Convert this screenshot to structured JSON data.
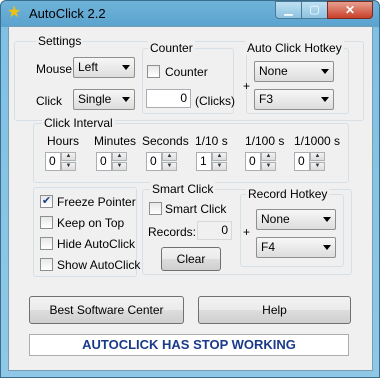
{
  "window": {
    "title": "AutoClick 2.2"
  },
  "settings": {
    "group_label": "Settings",
    "mouse_label": "Mouse",
    "mouse_value": "Left",
    "click_label": "Click",
    "click_value": "Single"
  },
  "counter": {
    "group_label": "Counter",
    "checkbox_label": "Counter",
    "checked": false,
    "value": "0",
    "unit": "(Clicks)"
  },
  "auto_click_hotkey": {
    "group_label": "Auto Click Hotkey",
    "modifier": "None",
    "plus": "+",
    "key": "F3"
  },
  "click_interval": {
    "group_label": "Click Interval",
    "fields": [
      {
        "label": "Hours",
        "value": "0"
      },
      {
        "label": "Minutes",
        "value": "0"
      },
      {
        "label": "Seconds",
        "value": "0"
      },
      {
        "label": "1/10 s",
        "value": "1"
      },
      {
        "label": "1/100 s",
        "value": "0"
      },
      {
        "label": "1/1000 s",
        "value": "0"
      }
    ]
  },
  "options": [
    {
      "label": "Freeze Pointer",
      "checked": true
    },
    {
      "label": "Keep on Top",
      "checked": false
    },
    {
      "label": "Hide AutoClick",
      "checked": false
    },
    {
      "label": "Show AutoClick",
      "checked": false
    }
  ],
  "smart_click": {
    "group_label": "Smart Click",
    "checkbox_label": "Smart Click",
    "checked": false,
    "records_label": "Records:",
    "records_value": "0",
    "clear_label": "Clear"
  },
  "record_hotkey": {
    "group_label": "Record Hotkey",
    "modifier": "None",
    "plus": "+",
    "key": "F4"
  },
  "buttons": {
    "best_software": "Best Software Center",
    "help": "Help"
  },
  "status": "AUTOCLICK HAS STOP WORKING",
  "check_mark": "✔"
}
